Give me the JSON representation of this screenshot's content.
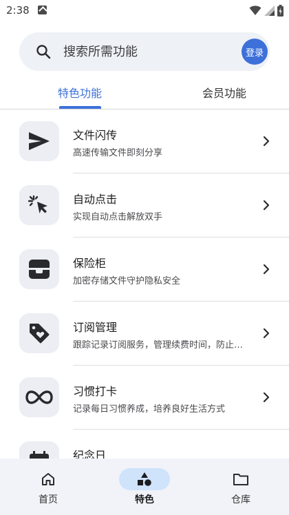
{
  "status_bar": {
    "time": "2:38",
    "icons": [
      "notification-icon",
      "wifi-icon",
      "signal-icon",
      "battery-icon"
    ]
  },
  "search": {
    "placeholder": "搜索所需功能",
    "login_label": "登录"
  },
  "tabs": [
    {
      "label": "特色功能",
      "active": true
    },
    {
      "label": "会员功能",
      "active": false
    }
  ],
  "features": [
    {
      "title": "文件闪传",
      "subtitle": "高速传输文件即刻分享",
      "icon": "send-icon"
    },
    {
      "title": "自动点击",
      "subtitle": "实现自动点击解放双手",
      "icon": "auto-click-icon"
    },
    {
      "title": "保险柜",
      "subtitle": "加密存储文件守护隐私安全",
      "icon": "vault-icon"
    },
    {
      "title": "订阅管理",
      "subtitle": "跟踪记录订阅服务，管理续费时间，防止遗忘",
      "icon": "tag-heart-icon"
    },
    {
      "title": "习惯打卡",
      "subtitle": "记录每日习惯养成，培养良好生活方式",
      "icon": "infinity-icon"
    },
    {
      "title": "纪念日",
      "subtitle": "",
      "icon": "calendar-icon"
    }
  ],
  "bottom_nav": [
    {
      "label": "首页",
      "icon": "home-icon",
      "active": false
    },
    {
      "label": "特色",
      "icon": "shapes-icon",
      "active": true
    },
    {
      "label": "仓库",
      "icon": "folder-icon",
      "active": false
    }
  ],
  "colors": {
    "accent": "#3d70d9",
    "search_bg": "#eef1f6",
    "nav_bg": "#f1f3f8",
    "nav_active_pill": "#cfe3fb",
    "icon_tile_bg": "#eceef3"
  }
}
